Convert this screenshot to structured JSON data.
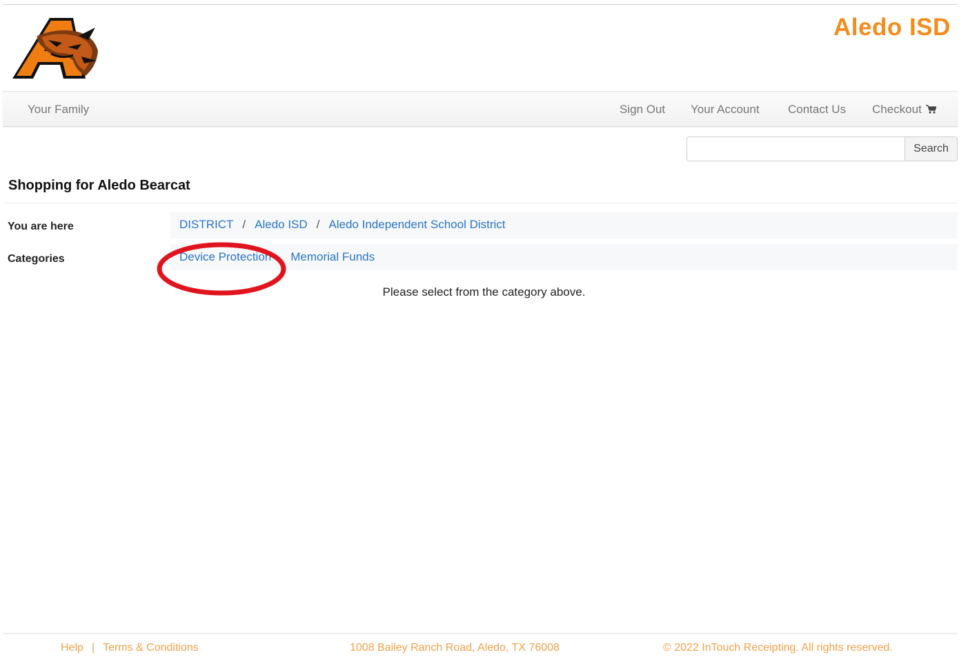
{
  "header": {
    "brand_text": "Aledo ISD",
    "logo_icon": "bearcat-letter-a-logo"
  },
  "nav": {
    "family": "Your Family",
    "sign_out": "Sign Out",
    "account": "Your Account",
    "contact": "Contact Us",
    "checkout": "Checkout",
    "checkout_icon": "cart-icon"
  },
  "search": {
    "value": "",
    "placeholder": "",
    "button_label": "Search"
  },
  "page": {
    "title": "Shopping for Aledo Bearcat",
    "breadcrumb_label": "You are here",
    "breadcrumbs": [
      "DISTRICT",
      "Aledo ISD",
      "Aledo Independent School District"
    ],
    "breadcrumb_separator": "/",
    "categories_label": "Categories",
    "categories": [
      "Device Protection",
      "Memorial Funds"
    ],
    "hint": "Please select from the category above."
  },
  "footer": {
    "help": "Help",
    "divider": "|",
    "terms": "Terms & Conditions",
    "address": "1008 Bailey Ranch Road, Aledo, TX 76008",
    "copyright": "© 2022 InTouch Receipting. All rights reserved."
  },
  "colors": {
    "brand_orange": "#f28c1e",
    "link_blue": "#2a74c8",
    "annotation_red": "#e0141e",
    "footer_orange": "#f2a04a"
  }
}
